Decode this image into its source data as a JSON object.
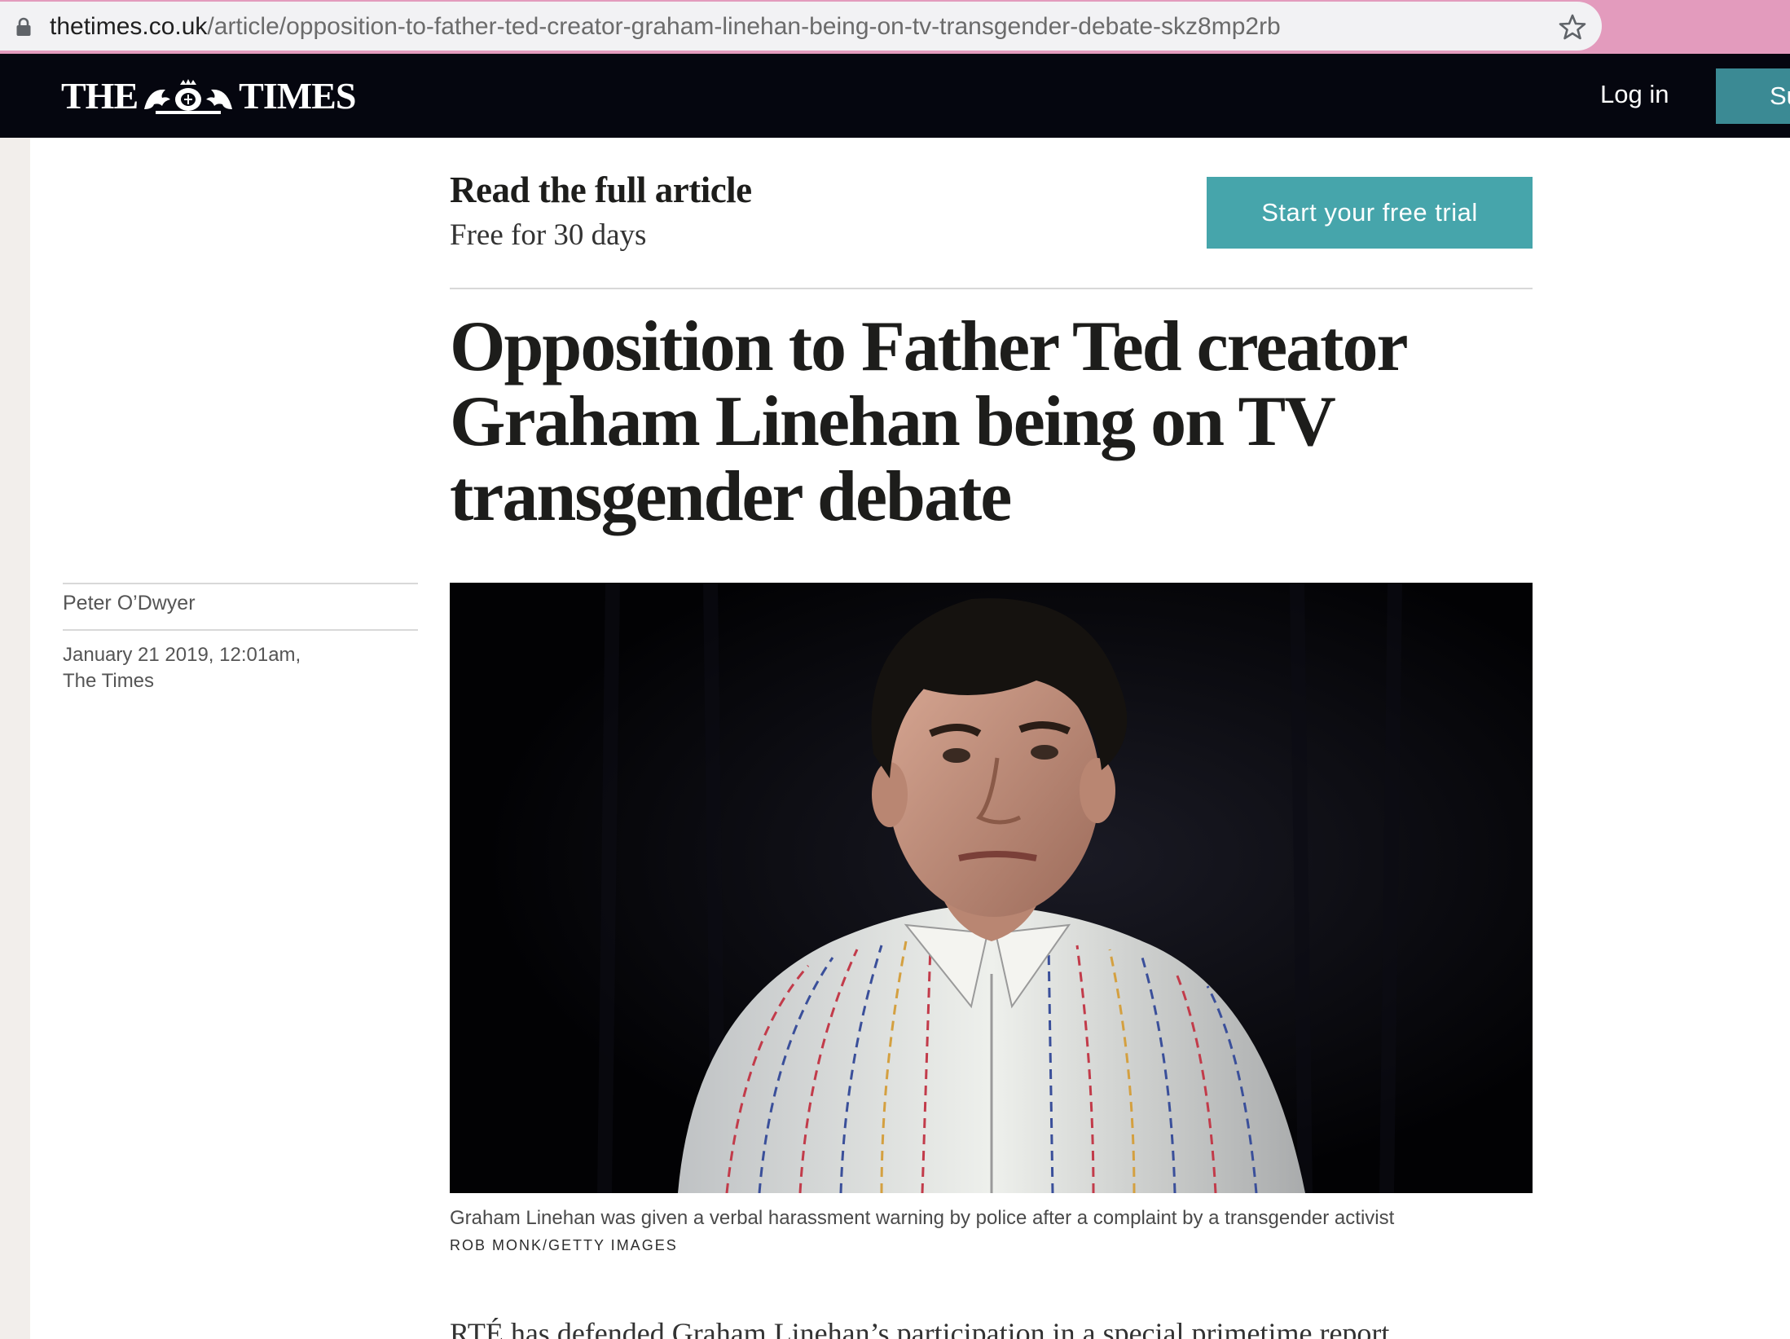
{
  "browser": {
    "url_host": "thetimes.co.uk",
    "url_path": "/article/opposition-to-father-ted-creator-graham-linehan-being-on-tv-transgender-debate-skz8mp2rb",
    "lock_icon": "lock-icon",
    "bookmark_icon": "star-icon"
  },
  "header": {
    "logo_left": "THE",
    "logo_right": "TIMES",
    "login_label": "Log in",
    "subscribe_label": "Su"
  },
  "promo": {
    "title": "Read the full article",
    "subtitle": "Free for 30 days",
    "button_label": "Start your free trial"
  },
  "article": {
    "headline": "Opposition to Father Ted creator Graham Linehan being on TV transgender debate",
    "author": "Peter O’Dwyer",
    "date": "January 21 2019, 12:01am,",
    "source": "The Times",
    "caption": "Graham Linehan was given a verbal harassment warning by police after a complaint by a transgender activist",
    "credit": "ROB MONK/GETTY IMAGES",
    "body_first_line": "RTÉ has defended Graham Linehan’s participation in a special primetime report"
  },
  "colors": {
    "header_bg": "#05060f",
    "trial_button": "#46a5ab",
    "subscribe_button": "#3b8a94",
    "browser_frame": "#e39bbd"
  }
}
